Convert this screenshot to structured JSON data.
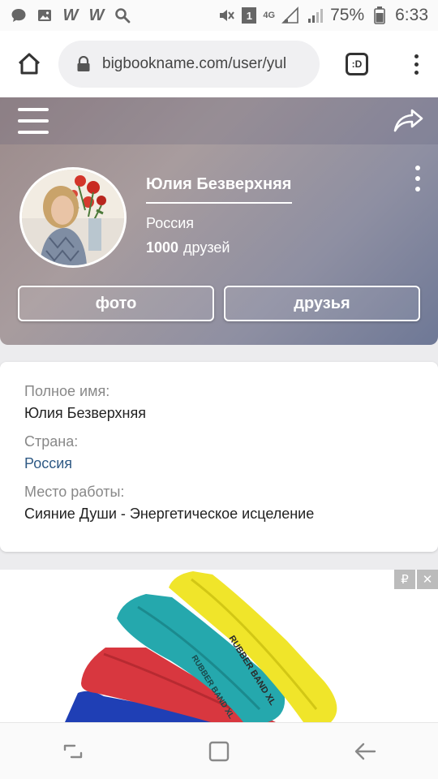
{
  "status_bar": {
    "battery_percent": "75%",
    "time": "6:33",
    "network_label": "4G",
    "sim_badge": "1",
    "icons": [
      "chat-icon",
      "image-icon",
      "w-icon",
      "w-icon",
      "search-icon",
      "mute-icon",
      "signal-icon",
      "battery-icon"
    ]
  },
  "browser": {
    "url": "bigbookname.com/user/yul",
    "tabs_label": ":D"
  },
  "profile": {
    "name": "Юлия Безверхняя",
    "country": "Россия",
    "friends_count": "1000",
    "friends_label": "друзей",
    "photos_button": "фото",
    "friends_button": "друзья"
  },
  "info": {
    "full_name_label": "Полное имя:",
    "full_name_value": "Юлия Безверхняя",
    "country_label": "Страна:",
    "country_value": "Россия",
    "work_label": "Место работы:",
    "work_value": "Сияние Души - Энергетическое исцеление"
  },
  "ad": {
    "ruble_badge": "₽",
    "close_badge": "✕",
    "band_text_1": "RUBBER BAND XL",
    "band_text_2": "RUBBER BAND XL"
  },
  "colors": {
    "accent_link": "#2f5a85",
    "header_gradient_start": "#9b8a8a",
    "header_gradient_end": "#6e7896"
  }
}
